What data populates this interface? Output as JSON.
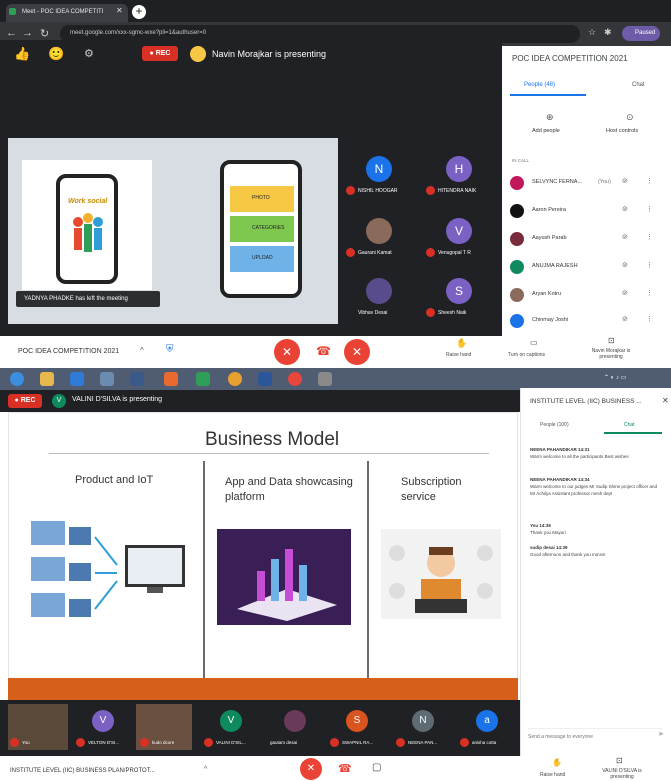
{
  "browser": {
    "tab_title": "Meet - POC IDEA COMPETITI",
    "url": "meet.google.com/xxx-sgmc-wxe?pli=1&authuser=0",
    "profile_label": "Paused"
  },
  "meeting1": {
    "rec_label": "REC",
    "presenting_text": "Navin Morajkar is presenting",
    "toast": "YADNYA PHADKE has left the meeting",
    "slide": {
      "logo_text": "Work social",
      "phone_items": [
        "PHOTO",
        "CATEGORIES",
        "UPLOAD"
      ]
    },
    "participants_tiles": [
      {
        "initial": "N",
        "name": "NISHIL HOOGAR",
        "color": "#1a73e8"
      },
      {
        "initial": "H",
        "name": "HITENDRA NAIK",
        "color": "#7b61c4"
      },
      {
        "initial": "",
        "name": "Gaurani Kamat",
        "color": "#8a6a5a"
      },
      {
        "initial": "V",
        "name": "Venugopal T R",
        "color": "#7b61c4"
      },
      {
        "initial": "",
        "name": "Vibhav Desai",
        "color": "#5a4b8c"
      },
      {
        "initial": "S",
        "name": "Sheesh Naik",
        "color": "#7b61c4"
      }
    ],
    "panel": {
      "title": "POC IDEA COMPETITION 2021",
      "tab_people": "People (48)",
      "tab_chat": "Chat",
      "add_people": "Add people",
      "host_controls": "Host controls",
      "section": "IN CALL",
      "people": [
        {
          "name": "SELVYNC FERNA...",
          "tag": "(You)",
          "color": "#c2185b"
        },
        {
          "name": "Aaron Pereira",
          "tag": "",
          "color": "#111111"
        },
        {
          "name": "Aayush Parab",
          "tag": "",
          "color": "#7a2b3b"
        },
        {
          "name": "ANUJMA RAJESH",
          "tag": "",
          "color": "#0f8a5f"
        },
        {
          "name": "Aryan Kotru",
          "tag": "",
          "color": "#8a6a5a"
        },
        {
          "name": "Chinmay Joshi",
          "tag": "",
          "color": "#1a73e8"
        }
      ]
    },
    "bottom": {
      "meeting_name": "POC IDEA COMPETITION 2021",
      "raise_hand": "Raise hand",
      "captions": "Turn on captions",
      "presenting": "Navin Morajkar is presenting"
    }
  },
  "meeting2": {
    "rec_label": "REC",
    "presenter_initial": "V",
    "presenting_text": "VALINI D'SILVA is presenting",
    "slide": {
      "title": "Business Model",
      "col1": "Product and IoT",
      "col2": "App and Data showcasing platform",
      "col3": "Subscription service"
    },
    "tiles": [
      {
        "initial": "",
        "name": "You",
        "color": "#5b4a3a"
      },
      {
        "initial": "V",
        "name": "VELTON D'SI...",
        "color": "#7b61c4"
      },
      {
        "initial": "",
        "name": "kudo dcore",
        "color": "#6a5040"
      },
      {
        "initial": "V",
        "name": "VALINI D'SIL...",
        "color": "#0f8a5f"
      },
      {
        "initial": "",
        "name": "gautam desai",
        "color": "#6a3a5a"
      },
      {
        "initial": "S",
        "name": "SWAPNIL RA...",
        "color": "#d9541e"
      },
      {
        "initial": "N",
        "name": "NEENA PAN...",
        "color": "#5f6b73"
      },
      {
        "initial": "a",
        "name": "anisha cotta",
        "color": "#1a73e8"
      }
    ],
    "panel": {
      "title": "INSTITUTE LEVEL (IIC) BUSINESS ...",
      "tab_people": "People (100)",
      "tab_chat": "Chat",
      "messages": [
        {
          "sender": "NEENA PAHANDIKAR 14:31",
          "text": "Warm welcome to all the participants Best wishes"
        },
        {
          "sender": "NEENA PAHANDIKAR 14:34",
          "text": "Warm welcome to our judges Mr Sudip Shine project officer and Mr Achilya Assistant professor mesh dept"
        },
        {
          "sender": "You 14:36",
          "text": "Thank you Mayuri"
        },
        {
          "sender": "sudip desai 14:39",
          "text": "Good afternoon and thank you ma'am"
        }
      ],
      "input_placeholder": "Send a message to everyone"
    },
    "bottom": {
      "meeting_name": "INSTITUTE LEVEL (IIC) BUSINESS PLAN/PROTOT...",
      "raise_hand": "Raise hand",
      "presenting": "VALINI D'SILVA is presenting"
    }
  },
  "colors": {
    "red": "#ea4335",
    "blue": "#1a73e8",
    "dark": "#202124",
    "orange": "#d6601b"
  }
}
